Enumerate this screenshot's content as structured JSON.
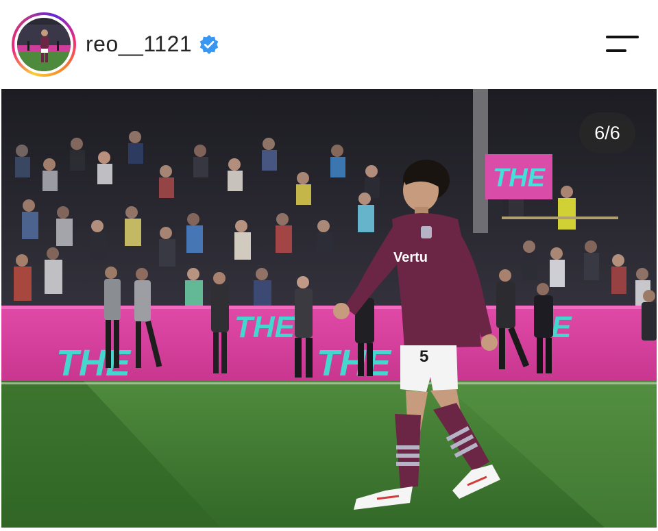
{
  "post_header": {
    "username": "reo__1121",
    "verified": true,
    "avatar_icon": "profile-photo",
    "menu_icon": "menu-icon"
  },
  "photo": {
    "description_icon": "post-photo",
    "counter": "6/6",
    "ad_board_text": "THE",
    "shirt_sponsor": "Vertu",
    "shirt_number": "5"
  },
  "colors": {
    "ring_gradient": [
      "#f9ce34",
      "#ee2a7b",
      "#6228d7"
    ],
    "verified_blue": "#3897f0",
    "kit_claret": "#6b2545",
    "pitch_green": "#3f7a35",
    "board_pink": "#d63ea3",
    "board_text": "#41d9d4"
  }
}
